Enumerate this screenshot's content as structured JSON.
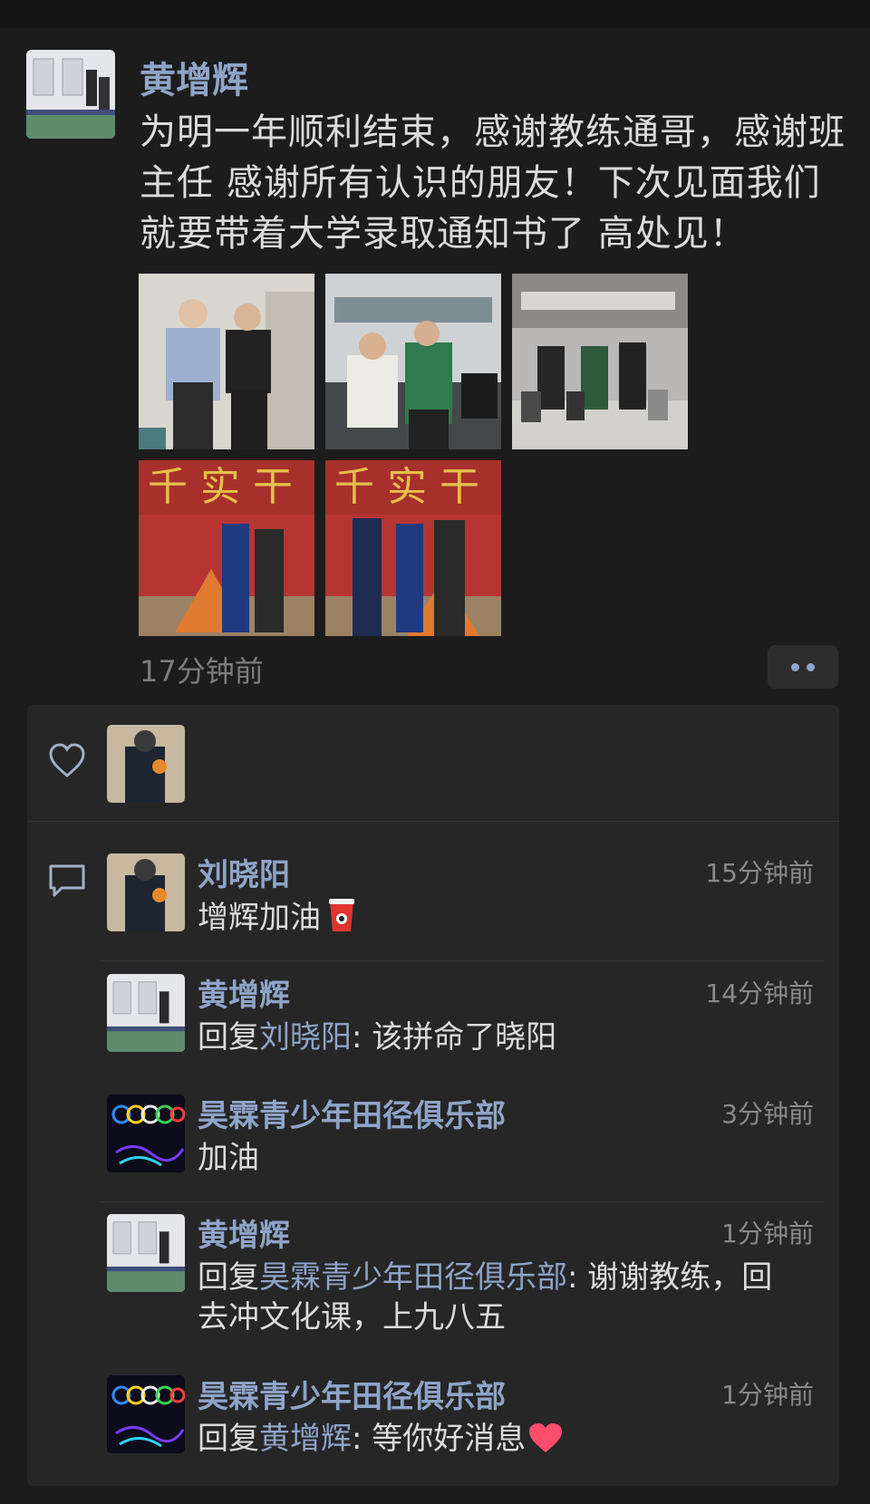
{
  "post": {
    "author": "黄增辉",
    "text": "为明一年顺利结束，感谢教练通哥，感谢班主任 感谢所有认识的朋友！下次见面我们就要带着大学录取通知书了 高处见！",
    "time": "17分钟前",
    "photo_count": 5
  },
  "likes": {
    "icon": "heart-outline-icon"
  },
  "comments": [
    {
      "name": "刘晓阳",
      "time": "15分钟前",
      "text": "增辉加油",
      "emoji": "cup-icon"
    },
    {
      "name": "黄增辉",
      "time": "14分钟前",
      "reply_prefix": "回复",
      "reply_to": "刘晓阳",
      "text": ": 该拼命了晓阳"
    },
    {
      "name": "昊霖青少年田径俱乐部",
      "time": "3分钟前",
      "text": "加油"
    },
    {
      "name": "黄增辉",
      "time": "1分钟前",
      "reply_prefix": "回复",
      "reply_to": "昊霖青少年田径俱乐部",
      "text": ": 谢谢教练，回去冲文化课，上九八五"
    },
    {
      "name": "昊霖青少年田径俱乐部",
      "time": "1分钟前",
      "reply_prefix": "回复",
      "reply_to": "黄增辉",
      "text": ": 等你好消息",
      "emoji": "heart-icon"
    }
  ],
  "colors": {
    "background": "#1c1c1c",
    "panel": "#262626",
    "name_link": "#8ea4c8",
    "text": "#dcdcdc",
    "muted": "#7d7d7d"
  }
}
